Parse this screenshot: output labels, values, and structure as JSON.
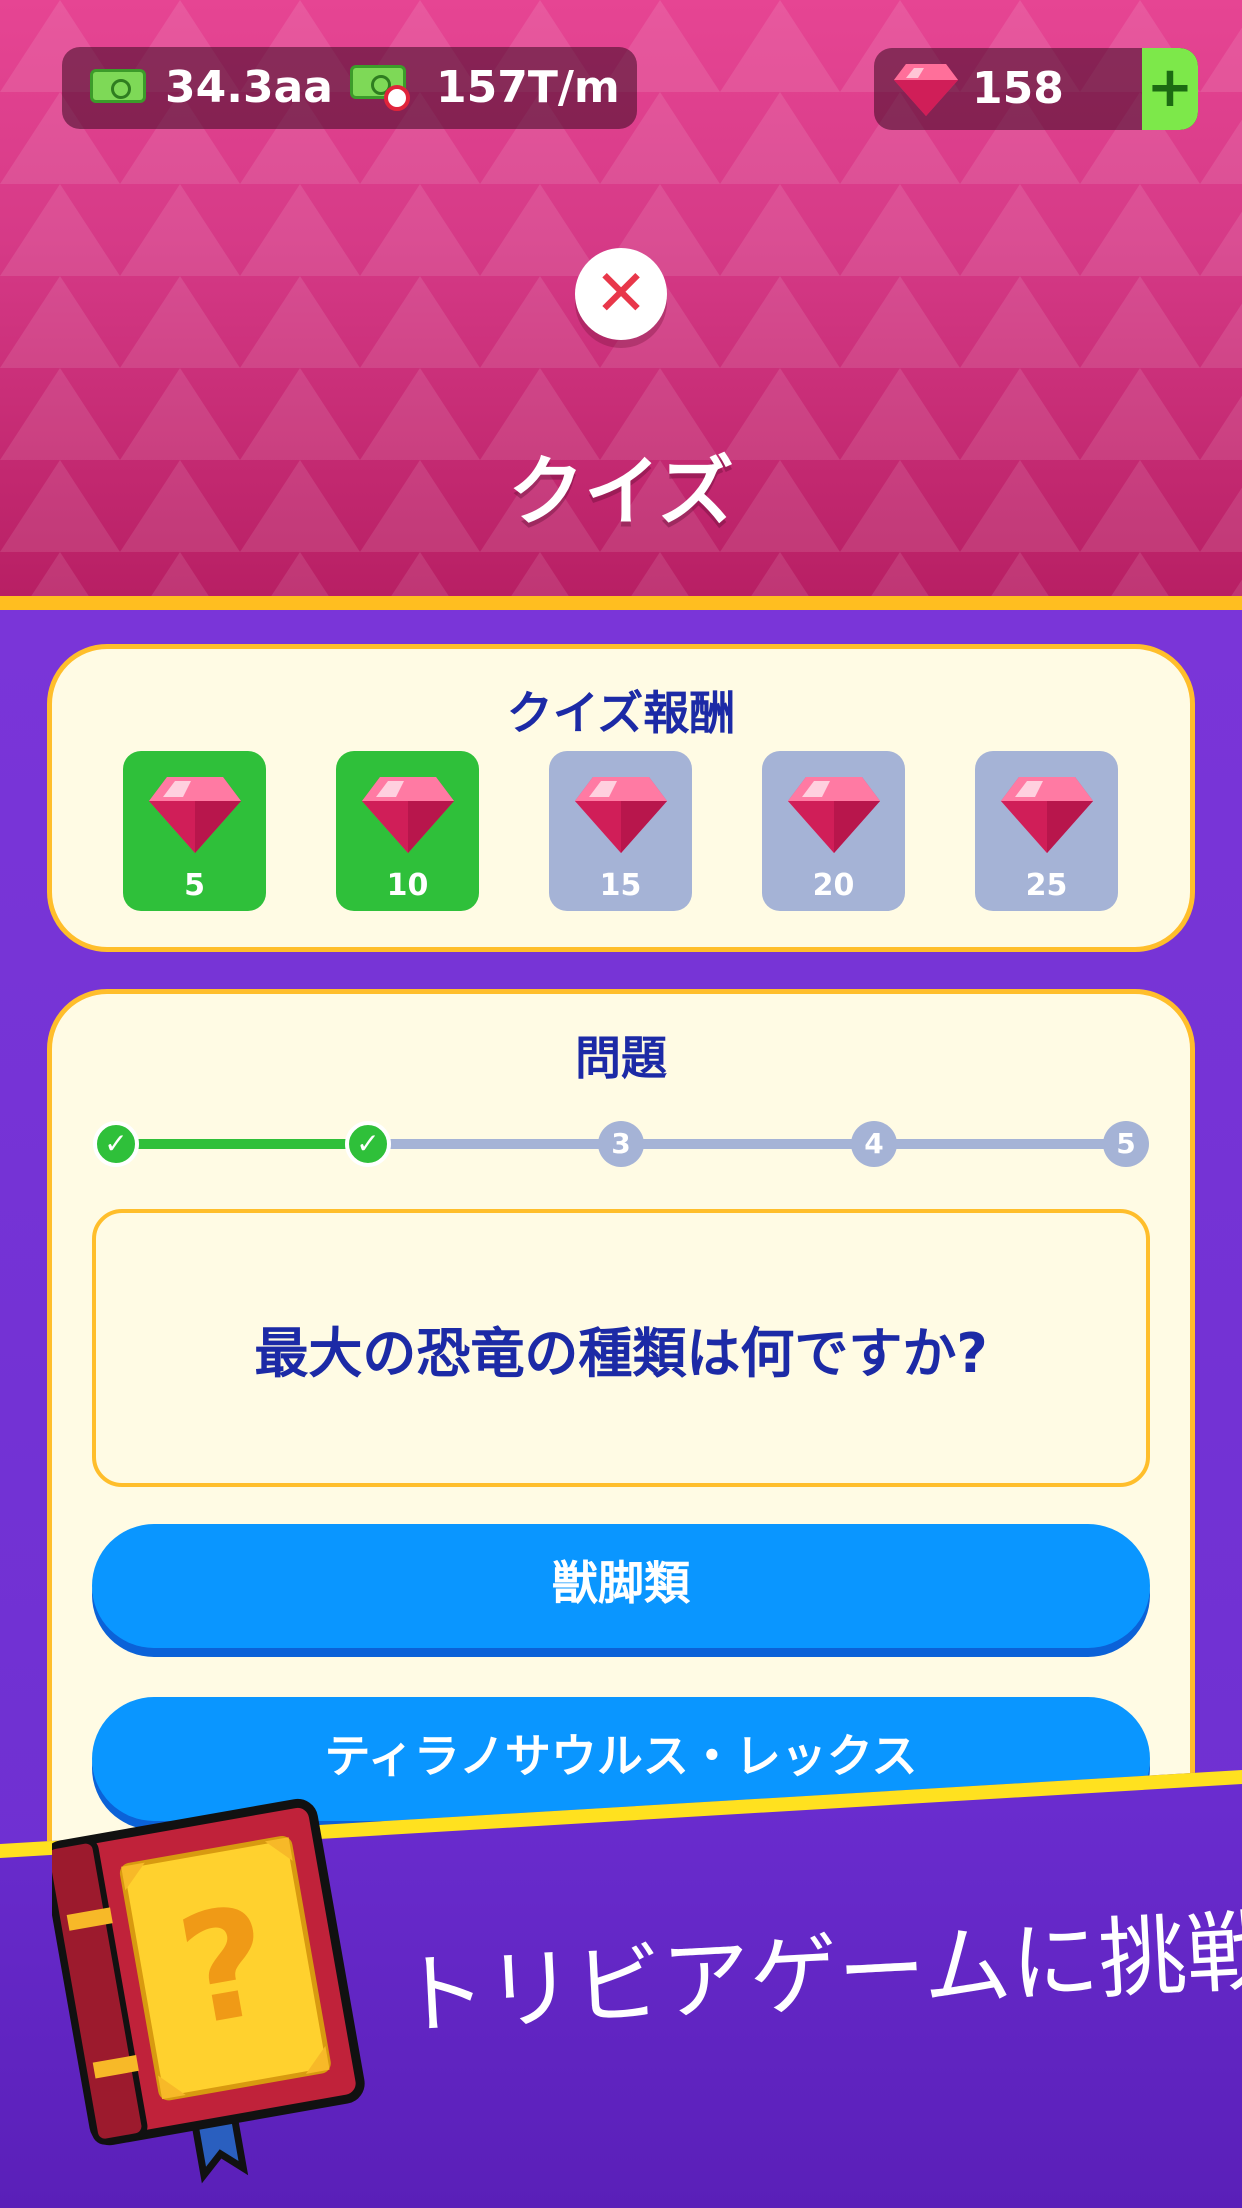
{
  "hud": {
    "cash": "34.3aa",
    "income_rate": "157T/m",
    "gems": "158",
    "add_label": "+"
  },
  "screen": {
    "close_label": "✕",
    "title": "クイズ"
  },
  "rewards": {
    "title": "クイズ報酬",
    "items": [
      {
        "amount": "5",
        "state": "earned"
      },
      {
        "amount": "10",
        "state": "earned"
      },
      {
        "amount": "15",
        "state": "locked"
      },
      {
        "amount": "20",
        "state": "locked"
      },
      {
        "amount": "25",
        "state": "locked"
      }
    ]
  },
  "question": {
    "title": "問題",
    "progress": {
      "current": 3,
      "steps": [
        {
          "label": "✓",
          "state": "done"
        },
        {
          "label": "✓",
          "state": "done"
        },
        {
          "label": "3",
          "state": "todo"
        },
        {
          "label": "4",
          "state": "todo"
        },
        {
          "label": "5",
          "state": "todo"
        }
      ]
    },
    "text": "最大の恐竜の種類は何ですか?",
    "answers": [
      "獣脚類",
      "ティラノサウルス・レックス"
    ]
  },
  "banner": {
    "text": "トリビアゲームに挑戦",
    "book_icon": "question-book-icon"
  },
  "colors": {
    "header_pink": "#d63a87",
    "background_purple": "#6c2fd0",
    "card_cream": "#fffbe4",
    "card_border": "#ffbe2b",
    "earned_green": "#2fc03a",
    "locked_gray": "#a5b3d6",
    "answer_blue": "#0a96ff",
    "text_navy": "#1c2aa6"
  }
}
